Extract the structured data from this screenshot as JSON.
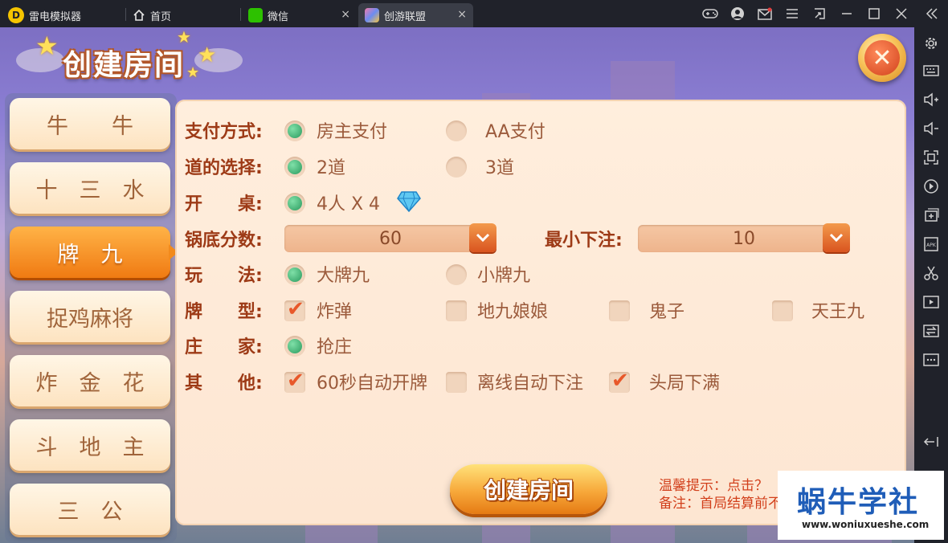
{
  "window": {
    "tabs": [
      {
        "label": "雷电模拟器",
        "icon": "leidian-logo-icon"
      },
      {
        "label": "首页",
        "icon": "home-icon"
      },
      {
        "label": "微信",
        "icon": "wechat-icon"
      },
      {
        "label": "创游联盟",
        "icon": "game-app-icon",
        "active": true
      }
    ],
    "app_logo_letter": "D",
    "close_glyph": "×"
  },
  "title": "创建房间",
  "close_glyph": "✕",
  "game_list": [
    "牛　　牛",
    "十　三　水",
    "牌　九",
    "捉鸡麻将",
    "炸　金　花",
    "斗　地　主",
    "三　公"
  ],
  "active_game_index": 2,
  "settings": {
    "payment": {
      "label": "支付方式:",
      "options": [
        "房主支付",
        "AA支付"
      ],
      "selected": 0
    },
    "roads": {
      "label": "道的选择:",
      "options": [
        "2道",
        "3道"
      ],
      "selected": 0
    },
    "table": {
      "label": "开　　桌:",
      "option": "4人 X 4"
    },
    "base_score": {
      "label": "锅底分数:",
      "value": "60"
    },
    "min_bet": {
      "label": "最小下注:",
      "value": "10"
    },
    "play_mode": {
      "label": "玩　　法:",
      "options": [
        "大牌九",
        "小牌九"
      ],
      "selected": 0
    },
    "card_types": {
      "label": "牌　　型:",
      "options": [
        "炸弹",
        "地九娘娘",
        "鬼子",
        "天王九"
      ],
      "checked": [
        true,
        false,
        false,
        false
      ]
    },
    "banker": {
      "label": "庄　　家:",
      "option": "抢庄"
    },
    "other": {
      "label": "其　　他:",
      "options": [
        "60秒自动开牌",
        "离线自动下注",
        "头局下满"
      ],
      "checked": [
        true,
        false,
        true
      ]
    }
  },
  "create_button": "创建房间",
  "hints": [
    "温馨提示：点击？",
    "备注：首局结算前不"
  ],
  "watermark": {
    "title": "蜗牛学社",
    "url": "www.woniuxueshe.com"
  },
  "colors": {
    "accent": "#f07a12",
    "label": "#9d3a16",
    "option": "#9b5a3b",
    "hint": "#d2401c"
  }
}
